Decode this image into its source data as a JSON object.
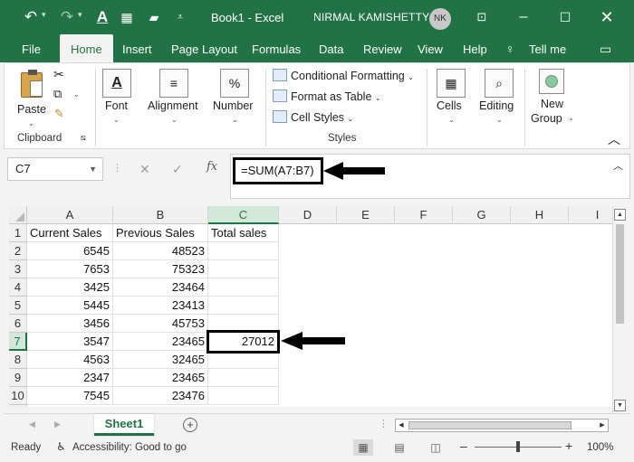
{
  "titlebar": {
    "title": "Book1 - Excel",
    "user_name": "NIRMAL KAMISHETTY",
    "user_initials": "NK"
  },
  "menu": {
    "tabs": [
      "File",
      "Home",
      "Insert",
      "Page Layout",
      "Formulas",
      "Data",
      "Review",
      "View",
      "Help",
      "Tell me"
    ],
    "active": "Home"
  },
  "ribbon": {
    "clipboard": {
      "paste": "Paste",
      "group": "Clipboard"
    },
    "font": "Font",
    "alignment": "Alignment",
    "number": "Number",
    "styles": {
      "conditional": "Conditional Formatting",
      "format_table": "Format as Table",
      "cell_styles": "Cell Styles",
      "group": "Styles"
    },
    "cells": "Cells",
    "editing": "Editing",
    "new_group": {
      "line1": "New",
      "line2": "Group"
    }
  },
  "formula_bar": {
    "name_box": "C7",
    "formula": "=SUM(A7:B7)"
  },
  "grid": {
    "columns": [
      "A",
      "B",
      "C",
      "D",
      "E",
      "F",
      "G",
      "H",
      "I"
    ],
    "selected_column": "C",
    "selected_row": "7",
    "rows": [
      {
        "num": "1",
        "a": "Current Sales",
        "b": "Previous Sales",
        "c": "Total sales"
      },
      {
        "num": "2",
        "a": "6545",
        "b": "48523",
        "c": ""
      },
      {
        "num": "3",
        "a": "7653",
        "b": "75323",
        "c": ""
      },
      {
        "num": "4",
        "a": "3425",
        "b": "23464",
        "c": ""
      },
      {
        "num": "5",
        "a": "5445",
        "b": "23413",
        "c": ""
      },
      {
        "num": "6",
        "a": "3456",
        "b": "45753",
        "c": ""
      },
      {
        "num": "7",
        "a": "3547",
        "b": "23465",
        "c": "27012"
      },
      {
        "num": "8",
        "a": "4563",
        "b": "32465",
        "c": ""
      },
      {
        "num": "9",
        "a": "2347",
        "b": "23465",
        "c": ""
      },
      {
        "num": "10",
        "a": "7545",
        "b": "23476",
        "c": ""
      }
    ]
  },
  "sheets": {
    "active": "Sheet1"
  },
  "status": {
    "ready": "Ready",
    "accessibility": "Accessibility: Good to go",
    "zoom": "100%",
    "zoom_fraction": 0.5
  },
  "colors": {
    "accent": "#217346",
    "ribbon_bg": "#ffffff",
    "window_bg": "#f3f3f3"
  }
}
